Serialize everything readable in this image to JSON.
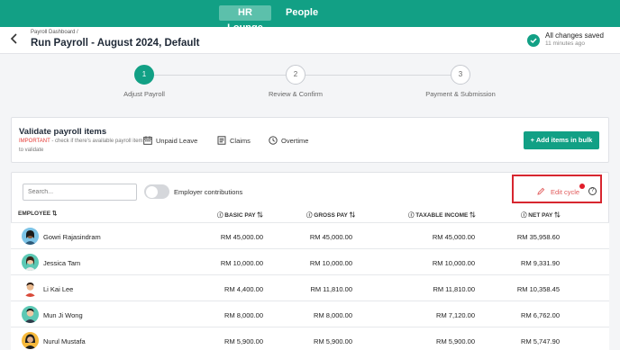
{
  "nav": {
    "active_tab": "HR Lounge",
    "other_tab": "People"
  },
  "header": {
    "breadcrumb": "Payroll Dashboard /",
    "title": "Run Payroll - August 2024, Default",
    "save_status": "All changes saved",
    "save_time": "11 minutes ago"
  },
  "steps": [
    {
      "number": "1",
      "label": "Adjust Payroll"
    },
    {
      "number": "2",
      "label": "Review & Confirm"
    },
    {
      "number": "3",
      "label": "Payment & Submission"
    }
  ],
  "validate": {
    "title": "Validate payroll items",
    "important": "IMPORTANT",
    "note": " - check if there's available payroll item to validate",
    "chips": [
      "Unpaid Leave",
      "Claims",
      "Overtime"
    ],
    "bulk_button": "+ Add items in bulk"
  },
  "toolbar": {
    "search_placeholder": "Search...",
    "toggle_label": "Employer contributions",
    "edit_cycle": "Edit cycle",
    "help": "?"
  },
  "table": {
    "columns": [
      "EMPLOYEE ⇅",
      "ⓘ BASIC PAY ⇅",
      "ⓘ GROSS PAY ⇅",
      "ⓘ TAXABLE INCOME ⇅",
      "ⓘ NET PAY ⇅"
    ],
    "rows": [
      {
        "name": "Gowri Rajasindram",
        "basic": "RM 45,000.00",
        "gross": "RM 45,000.00",
        "taxable": "RM 45,000.00",
        "net": "RM 35,958.60"
      },
      {
        "name": "Jessica Tam",
        "basic": "RM 10,000.00",
        "gross": "RM 10,000.00",
        "taxable": "RM 10,000.00",
        "net": "RM 9,331.90"
      },
      {
        "name": "Li Kai Lee",
        "basic": "RM 4,400.00",
        "gross": "RM 11,810.00",
        "taxable": "RM 11,810.00",
        "net": "RM 10,358.45"
      },
      {
        "name": "Mun Ji Wong",
        "basic": "RM 8,000.00",
        "gross": "RM 8,000.00",
        "taxable": "RM 7,120.00",
        "net": "RM 6,762.00"
      },
      {
        "name": "Nurul Mustafa",
        "basic": "RM 5,900.00",
        "gross": "RM 5,900.00",
        "taxable": "RM 5,900.00",
        "net": "RM 5,747.90"
      }
    ]
  },
  "colors": {
    "brand": "#12a085",
    "highlight": "#d7262f"
  }
}
